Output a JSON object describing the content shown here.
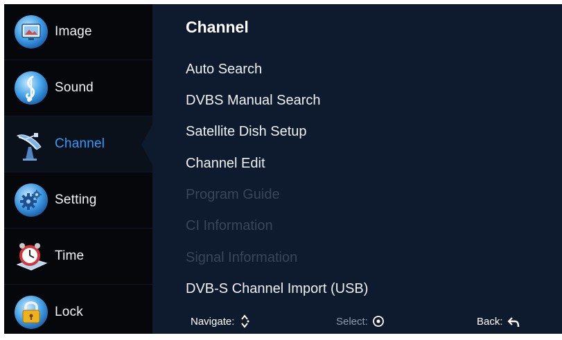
{
  "sidebar": {
    "items": [
      {
        "label": "Image",
        "icon": "image-icon"
      },
      {
        "label": "Sound",
        "icon": "music-note-icon"
      },
      {
        "label": "Channel",
        "icon": "satellite-dish-icon",
        "selected": true
      },
      {
        "label": "Setting",
        "icon": "gear-icon"
      },
      {
        "label": "Time",
        "icon": "alarm-clock-icon"
      },
      {
        "label": "Lock",
        "icon": "padlock-icon"
      }
    ]
  },
  "main": {
    "title": "Channel",
    "items": [
      {
        "label": "Auto Search",
        "enabled": true
      },
      {
        "label": "DVBS Manual Search",
        "enabled": true
      },
      {
        "label": "Satellite Dish Setup",
        "enabled": true
      },
      {
        "label": "Channel Edit",
        "enabled": true
      },
      {
        "label": "Program Guide",
        "enabled": false
      },
      {
        "label": "CI Information",
        "enabled": false
      },
      {
        "label": "Signal Information",
        "enabled": false
      },
      {
        "label": "DVB-S Channel Import (USB)",
        "enabled": true
      }
    ]
  },
  "footer": {
    "navigate": "Navigate:",
    "select": "Select:",
    "back": "Back:"
  },
  "colors": {
    "selected_text": "#2f9cff",
    "panel_background": "#0e1a2e",
    "sidebar_background": "#05070b",
    "disabled_text": "#38465c"
  }
}
